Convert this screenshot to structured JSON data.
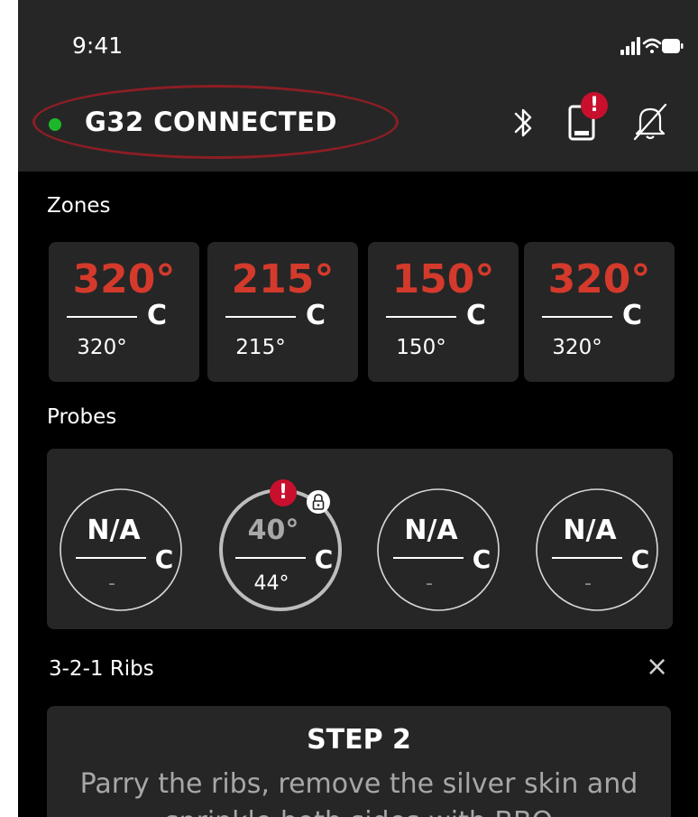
{
  "status": {
    "time": "9:41"
  },
  "header": {
    "connection_label": "G32 CONNECTED",
    "alert_mark": "!"
  },
  "zones": {
    "label": "Zones",
    "items": [
      {
        "current": "320°",
        "unit": "C",
        "set": "320°"
      },
      {
        "current": "215°",
        "unit": "C",
        "set": "215°"
      },
      {
        "current": "150°",
        "unit": "C",
        "set": "150°"
      },
      {
        "current": "320°",
        "unit": "C",
        "set": "320°"
      }
    ]
  },
  "probes": {
    "label": "Probes",
    "alert_mark": "!",
    "items": [
      {
        "current": "N/A",
        "unit": "C",
        "target": "-"
      },
      {
        "current": "40°",
        "unit": "C",
        "target": "44°"
      },
      {
        "current": "N/A",
        "unit": "C",
        "target": "-"
      },
      {
        "current": "N/A",
        "unit": "C",
        "target": "-"
      }
    ]
  },
  "recipe": {
    "name": "3-2-1 Ribs",
    "close_glyph": "×",
    "step_title": "STEP 2",
    "step_text": "Parry the ribs, remove the silver skin and sprinkle both sides with BBQ"
  },
  "colors": {
    "accent_red": "#d33a2c",
    "connected_green": "#1db82a",
    "panel": "#262626"
  }
}
